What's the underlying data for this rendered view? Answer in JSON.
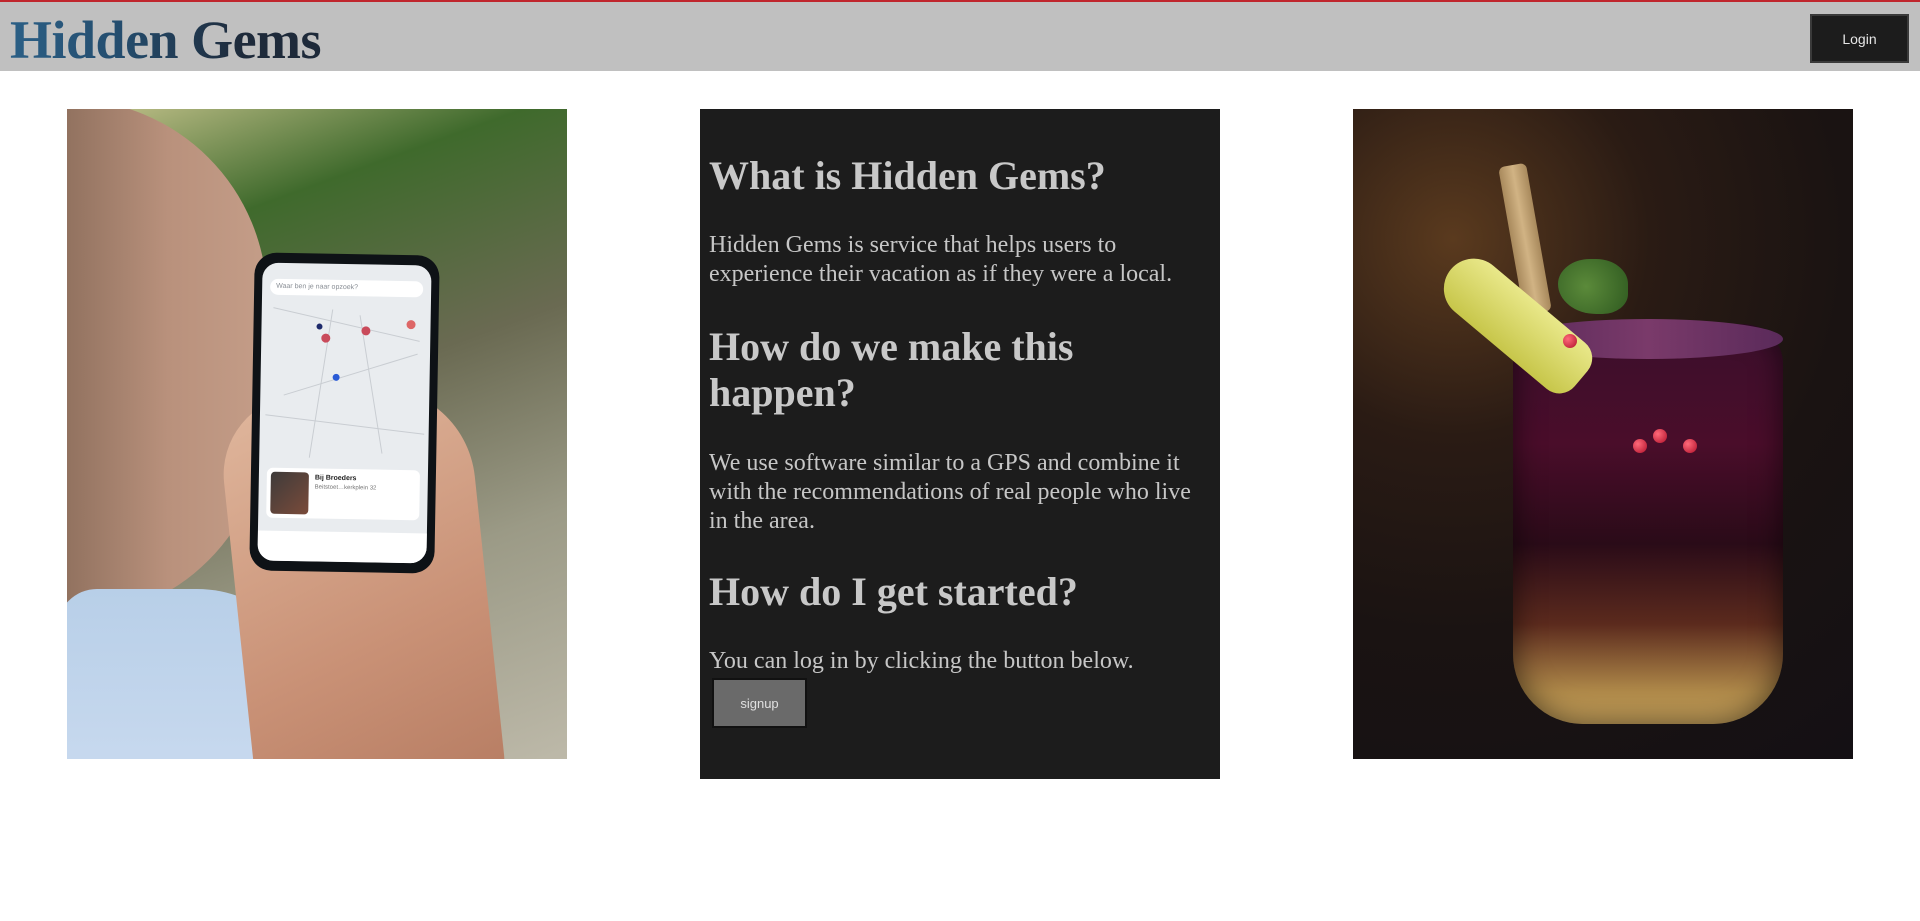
{
  "header": {
    "brand": "Hidden Gems",
    "login_label": "Login"
  },
  "left_photo": {
    "phone_search_placeholder": "Waar ben je naar opzoek?",
    "card_title": "Bij Broeders",
    "card_subtitle": "Beitstoet…kerkplein 32"
  },
  "info": {
    "what_heading": "What is Hidden Gems?",
    "what_text": "Hidden Gems is service that helps users to experience their vacation as if they were a local.",
    "how_heading": "How do we make this happen?",
    "how_text": "We use software similar to a GPS and combine it with the recommendations of real people who live in the area.",
    "start_heading": "How do I get started?",
    "start_text": "You can log in by clicking the button below.",
    "signup_label": "signup"
  },
  "colors": {
    "header_bg": "#c0c0c0",
    "top_accent": "#c0262d",
    "panel_bg": "#1c1c1c",
    "panel_text": "#c6c6c6",
    "button_dark": "#1c1c1c",
    "button_gray": "#6a6a6a"
  }
}
